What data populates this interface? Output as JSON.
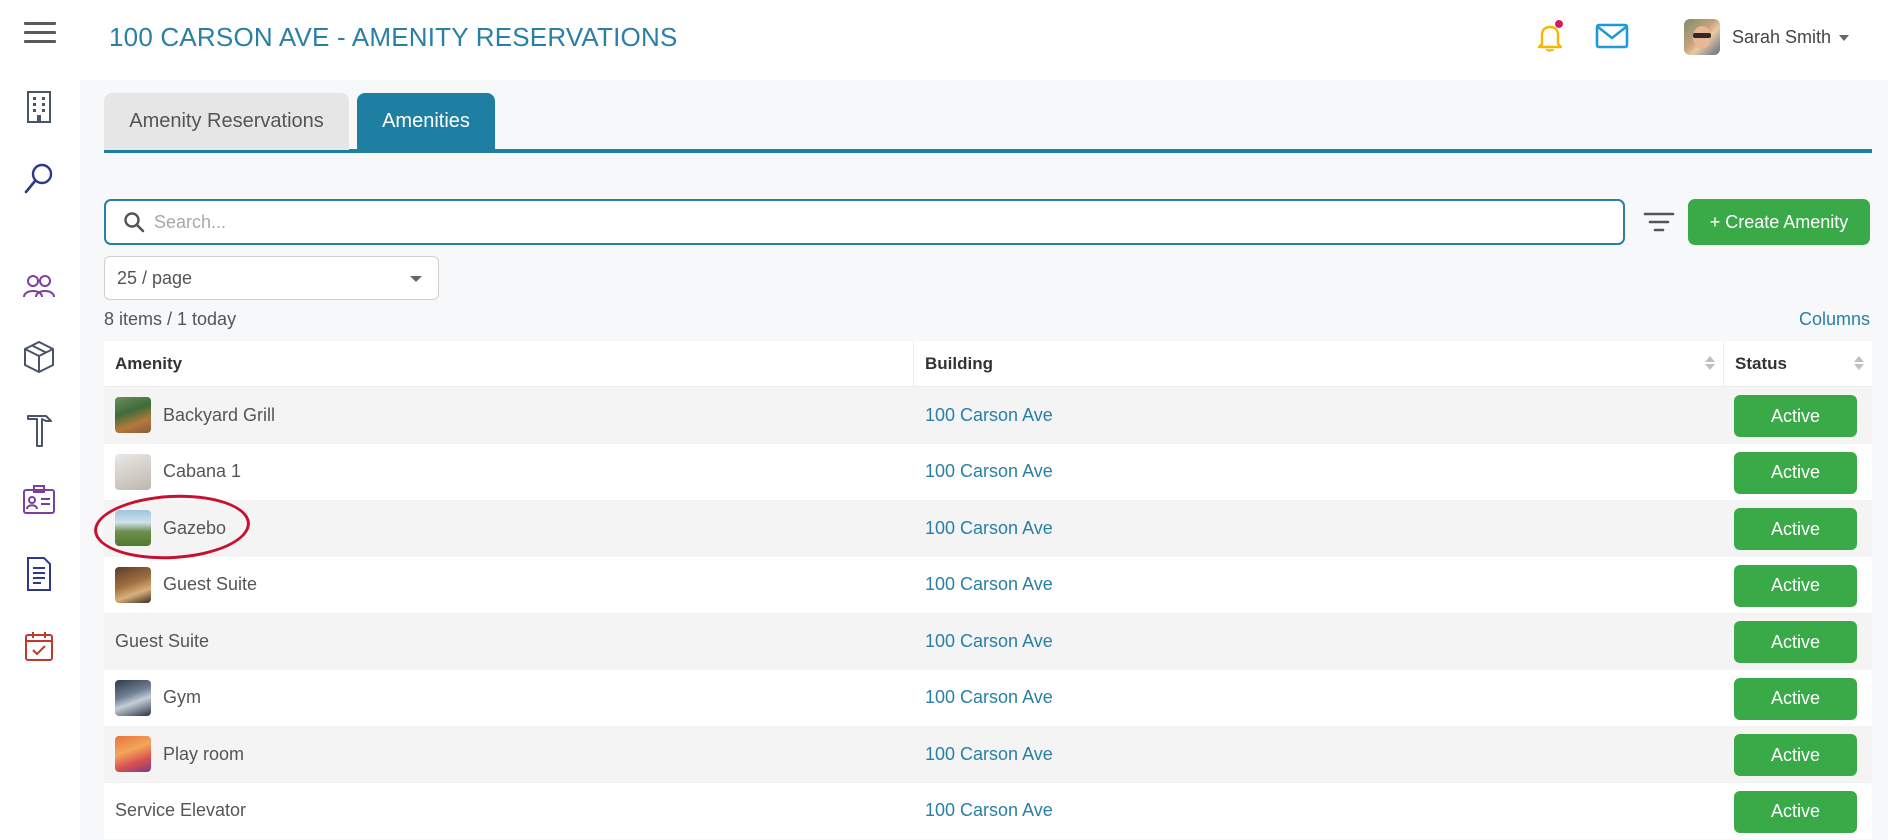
{
  "header": {
    "title": "100 CARSON AVE - AMENITY RESERVATIONS",
    "user_name": "Sarah Smith"
  },
  "sidebar": {
    "icons": [
      "building-icon",
      "search-icon",
      "people-icon",
      "package-icon",
      "hammer-icon",
      "id-card-icon",
      "document-icon",
      "calendar-check-icon"
    ]
  },
  "tabs": [
    {
      "label": "Amenity Reservations",
      "active": false
    },
    {
      "label": "Amenities",
      "active": true
    }
  ],
  "search": {
    "placeholder": "Search...",
    "value": ""
  },
  "create_button_label": "+ Create Amenity",
  "per_page": "25 / page",
  "count_text": "8 items / 1 today",
  "columns_link": "Columns",
  "table": {
    "headers": [
      "Amenity",
      "Building",
      "Status"
    ],
    "rows": [
      {
        "amenity": "Backyard Grill",
        "building": "100 Carson Ave",
        "status": "Active",
        "thumb": "grill"
      },
      {
        "amenity": "Cabana 1",
        "building": "100 Carson Ave",
        "status": "Active",
        "thumb": "cabana"
      },
      {
        "amenity": "Gazebo",
        "building": "100 Carson Ave",
        "status": "Active",
        "thumb": "gazebo"
      },
      {
        "amenity": "Guest Suite",
        "building": "100 Carson Ave",
        "status": "Active",
        "thumb": "suite"
      },
      {
        "amenity": "Guest Suite",
        "building": "100 Carson Ave",
        "status": "Active",
        "thumb": ""
      },
      {
        "amenity": "Gym",
        "building": "100 Carson Ave",
        "status": "Active",
        "thumb": "gym"
      },
      {
        "amenity": "Play room",
        "building": "100 Carson Ave",
        "status": "Active",
        "thumb": "playroom"
      },
      {
        "amenity": "Service Elevator",
        "building": "100 Carson Ave",
        "status": "Active",
        "thumb": ""
      }
    ]
  },
  "colors": {
    "primary": "#2a7fa6",
    "tab_active": "#1f7fa3",
    "success": "#3aaa49",
    "highlight": "#c8102e",
    "bell": "#f5b800"
  }
}
